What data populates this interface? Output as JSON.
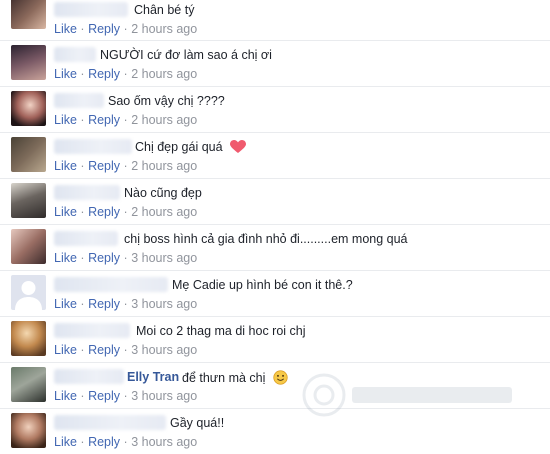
{
  "actions": {
    "like": "Like",
    "reply": "Reply",
    "separator": "·"
  },
  "comments": [
    {
      "text": "Chân bé tý",
      "time": "2 hours ago"
    },
    {
      "text": "NGƯỜI cứ đơ làm sao á chị ơi",
      "time": "2 hours ago"
    },
    {
      "text": "Sao ốm vậy chị ????",
      "time": "2 hours ago"
    },
    {
      "text": "Chị đẹp gái quá",
      "time": "2 hours ago",
      "emoji": "heart-icon"
    },
    {
      "text": "Nào cũng đẹp",
      "time": "2 hours ago"
    },
    {
      "text": "chị boss hình cả gia đình nhỏ đi.........em mong quá",
      "time": "3 hours ago"
    },
    {
      "text": "Mẹ Cadie up hình bé con it thê.?",
      "time": "3 hours ago"
    },
    {
      "text": "Moi co 2 thag ma di hoc roi chj",
      "time": "3 hours ago"
    },
    {
      "name": "Elly Tran",
      "text": "để thưn mà chị",
      "time": "3 hours ago",
      "emoji": "smiley-icon"
    },
    {
      "text": "Gầy quá!!",
      "time": "3 hours ago"
    }
  ]
}
